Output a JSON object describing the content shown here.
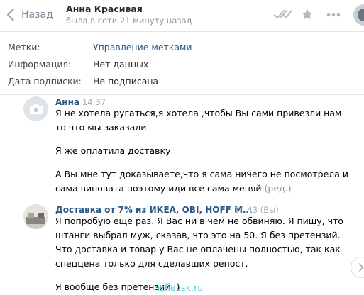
{
  "header": {
    "back_label": "Назад",
    "peer_name": "Анна Красивая",
    "peer_status": "была в сети 21 минуту назад"
  },
  "info": {
    "rows": [
      {
        "label": "Метки:",
        "value": "Управление метками"
      },
      {
        "label": "Информация:",
        "value": "Нет данных"
      },
      {
        "label": "Дата подписки:",
        "value": "Не подписана"
      }
    ]
  },
  "messages": [
    {
      "author": "Анна",
      "time": "14:37",
      "paragraphs": [
        "Я не хотела ругаться,я хотела ,чтобы Вы сами привезли нам то что мы заказали",
        "Я же оплатила доставку",
        "А Вы мне тут доказываете,что я сама ничего не посмотрела и сама виновата поэтому иди все сама меняй"
      ],
      "edited_label": "(ред.)"
    },
    {
      "author": "Доставка от 7% из ИКЕА, OBI, HOFF M...",
      "time": "14:43 (Вы)",
      "paragraphs": [
        "Я попробую еще раз. Я Вас ни в чем не обвиняю. Я пишу, что штанги выбрал муж, сказав, что это на 50. Я без претензий. Что доставка и товар у Вас не оплачены полностью, так как спеццена только для сделавших репост.",
        "Я вообще без претензий :)"
      ]
    }
  ],
  "watermark": "izhevsk.ru",
  "colors": {
    "link": "#2a5885",
    "muted": "#939393",
    "watermark": "#54c8d8"
  }
}
